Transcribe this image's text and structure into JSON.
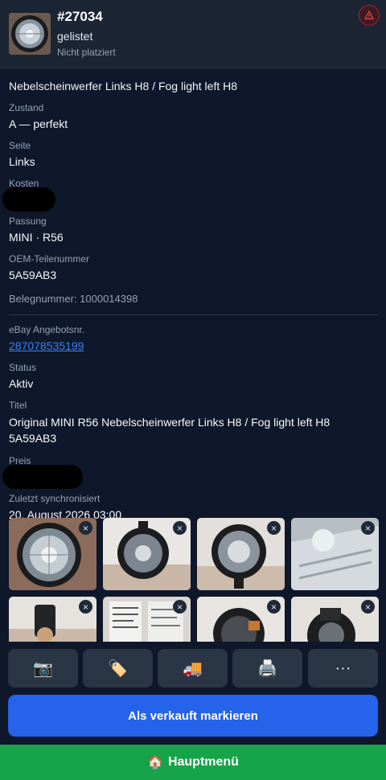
{
  "header": {
    "id": "#27034",
    "status": "gelistet",
    "placement": "Nicht platziert"
  },
  "product": {
    "title": "Nebelscheinwerfer Links H8 / Fog light left H8",
    "fields": [
      {
        "label": "Zustand",
        "value": "A — perfekt"
      },
      {
        "label": "Seite",
        "value": "Links"
      },
      {
        "label": "Kosten",
        "value": ""
      },
      {
        "label": "Passung",
        "value": "MINI · R56"
      },
      {
        "label": "OEM-Teilenummer",
        "value": "5A59AB3"
      }
    ],
    "beleg": "Belegnummer: 1000014398"
  },
  "ebay": {
    "fields": [
      {
        "label": "eBay Angebotsnr.",
        "value": "287078535199"
      },
      {
        "label": "Status",
        "value": "Aktiv"
      },
      {
        "label": "Titel",
        "value": "Original MINI R56 Nebelscheinwerfer Links H8 / Fog light left H8 5A59AB3"
      },
      {
        "label": "Preis",
        "value": ""
      },
      {
        "label": "Zuletzt synchronisiert",
        "value": "20. August 2026 03:00"
      }
    ]
  },
  "gallery": {
    "photos": [
      {
        "name": "photo-1"
      },
      {
        "name": "photo-2"
      },
      {
        "name": "photo-3"
      },
      {
        "name": "photo-4"
      },
      {
        "name": "photo-5"
      },
      {
        "name": "photo-6"
      },
      {
        "name": "photo-7"
      },
      {
        "name": "photo-8"
      }
    ],
    "remove_glyph": "×"
  },
  "actions": {
    "buttons": [
      {
        "icon": "camera-icon",
        "glyph": "📷"
      },
      {
        "icon": "tag-icon",
        "glyph": "🏷️"
      },
      {
        "icon": "truck-icon",
        "glyph": "🚚"
      },
      {
        "icon": "printer-icon",
        "glyph": "🖨️"
      },
      {
        "icon": "more-icon",
        "glyph": "···"
      }
    ],
    "primary_label": "Als verkauft markieren"
  },
  "footer": {
    "home_glyph": "🏠",
    "home_label": "Hauptmenü"
  },
  "colors": {
    "background": "#0f172a",
    "header": "#1c2533",
    "accent": "#2563eb",
    "success": "#16a34a",
    "danger": "#b91c1c",
    "link": "#3b82f6"
  }
}
